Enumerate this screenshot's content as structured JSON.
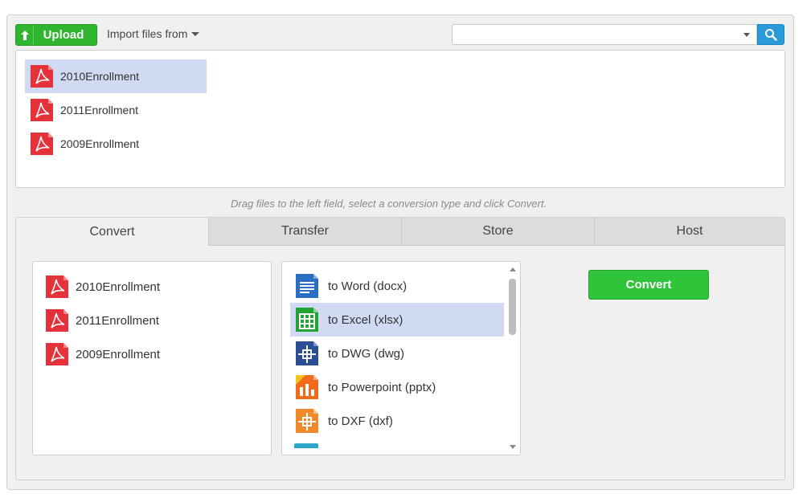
{
  "toolbar": {
    "upload_label": "Upload",
    "import_label": "Import files from",
    "search_value": ""
  },
  "files": [
    {
      "name": "2010Enrollment",
      "selected": true
    },
    {
      "name": "2011Enrollment",
      "selected": false
    },
    {
      "name": "2009Enrollment",
      "selected": false
    }
  ],
  "hint": "Drag files to the left field, select a conversion type and click Convert.",
  "tabs": [
    {
      "label": "Convert",
      "active": true
    },
    {
      "label": "Transfer",
      "active": false
    },
    {
      "label": "Store",
      "active": false
    },
    {
      "label": "Host",
      "active": false
    }
  ],
  "convert_files": [
    "2010Enrollment",
    "2011Enrollment",
    "2009Enrollment"
  ],
  "conversions": [
    {
      "label": "to Word (docx)",
      "icon": "word-icon",
      "color": "#2b6fc4",
      "selected": false
    },
    {
      "label": "to Excel (xlsx)",
      "icon": "excel-icon",
      "color": "#21a336",
      "selected": true
    },
    {
      "label": "to DWG (dwg)",
      "icon": "dwg-icon",
      "color": "#2b4d94",
      "selected": false
    },
    {
      "label": "to Powerpoint (pptx)",
      "icon": "powerpoint-icon",
      "color": "#f26b1d",
      "selected": false
    },
    {
      "label": "to DXF (dxf)",
      "icon": "dxf-icon",
      "color": "#f0892a",
      "selected": false
    }
  ],
  "convert_button": "Convert",
  "colors": {
    "accent_green": "#2fb52f",
    "search_blue": "#2a9bd8",
    "selection": "#d1daf3",
    "pdf_red": "#e5323a"
  }
}
